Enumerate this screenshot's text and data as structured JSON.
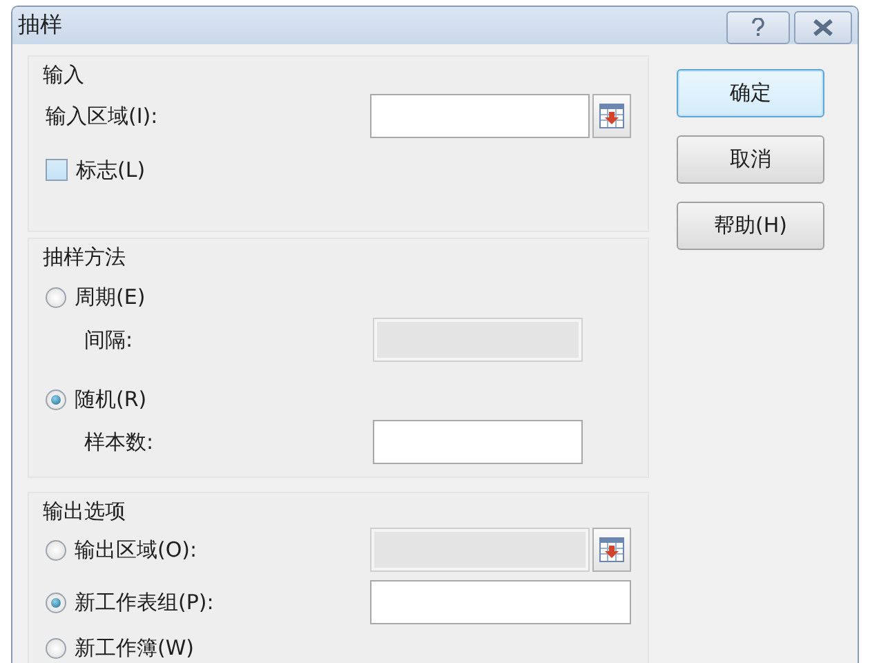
{
  "window": {
    "title": "抽样"
  },
  "input_group": {
    "title": "输入",
    "range": {
      "label": "输入区域(I):",
      "disabled": false,
      "ref_button": true
    },
    "labels_option": {
      "label": "标志(L)",
      "checked": false
    }
  },
  "method_group": {
    "title": "抽样方法",
    "options": [
      {
        "label": "周期(E)",
        "selected": false,
        "field": {
          "label": "间隔:",
          "disabled": true
        }
      },
      {
        "label": "随机(R)",
        "selected": true,
        "field": {
          "label": "样本数:",
          "disabled": false
        }
      }
    ]
  },
  "output_group": {
    "title": "输出选项",
    "options": [
      {
        "label": "输出区域(O):",
        "selected": false,
        "field": {
          "disabled": true,
          "ref_button": true
        }
      },
      {
        "label": "新工作表组(P):",
        "selected": true,
        "field": {
          "disabled": false
        }
      },
      {
        "label": "新工作簿(W)",
        "selected": false
      }
    ]
  },
  "buttons": [
    {
      "label": "确定",
      "default": true
    },
    {
      "label": "取消",
      "default": false
    },
    {
      "label": "帮助(H)",
      "default": false
    }
  ]
}
